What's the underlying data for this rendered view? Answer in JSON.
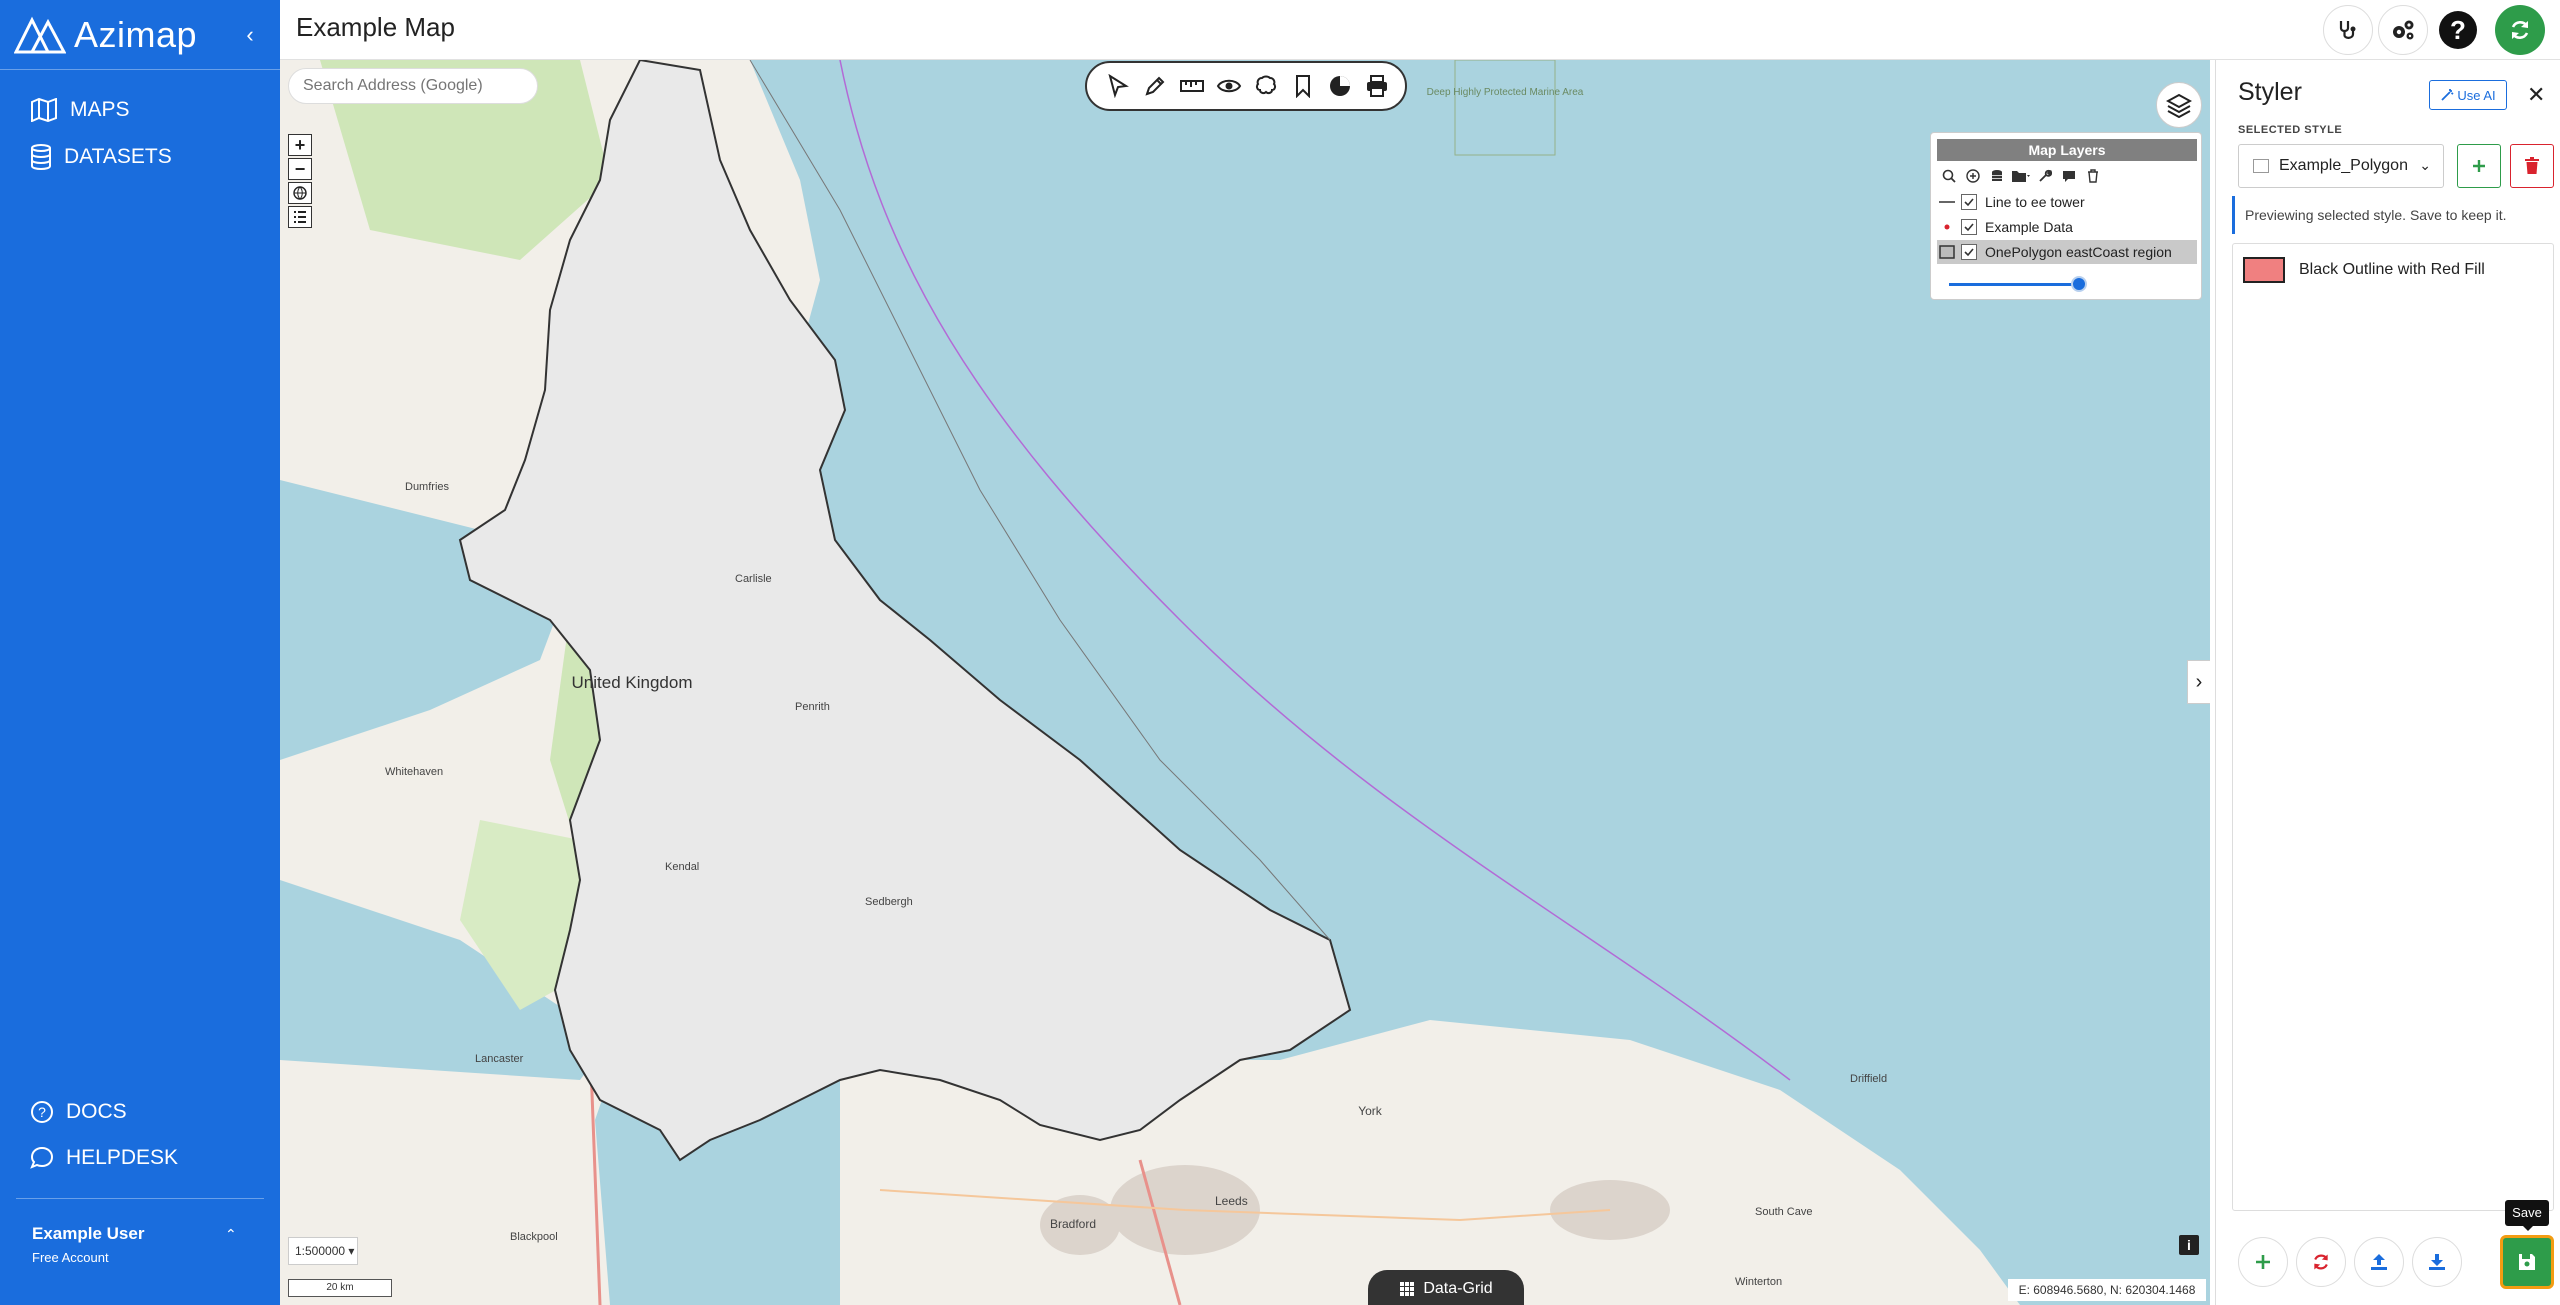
{
  "app": {
    "logo_text": "Azimap",
    "page_title": "Example Map"
  },
  "sidebar": {
    "items": [
      {
        "label": "MAPS",
        "icon": "map-icon"
      },
      {
        "label": "DATASETS",
        "icon": "database-icon"
      }
    ],
    "bottom_items": [
      {
        "label": "DOCS",
        "icon": "question-circle-icon"
      },
      {
        "label": "HELPDESK",
        "icon": "chat-bubble-icon"
      }
    ],
    "user": {
      "name": "Example User",
      "plan": "Free Account"
    }
  },
  "map": {
    "search_placeholder": "Search Address (Google)",
    "scale_value": "1:500000",
    "scale_bar_label": "20 km",
    "coordinates": "E: 608946.5680, N: 620304.1468",
    "data_grid_label": "Data-Grid",
    "place_labels": {
      "uk": "United Kingdom",
      "york": "York",
      "leeds": "Leeds",
      "bradford": "Bradford",
      "lancaster": "Lancaster",
      "kendal": "Kendal",
      "penrith": "Penrith",
      "carlisle": "Carlisle",
      "dumfries": "Dumfries",
      "whitehaven": "Whitehaven",
      "blackpool": "Blackpool",
      "sedbergh": "Sedbergh",
      "south_cave": "South Cave",
      "driffield": "Driffield",
      "winterton": "Winterton",
      "deep_protected": "Deep Highly Protected Marine Area"
    }
  },
  "layers_panel": {
    "title": "Map Layers",
    "layers": [
      {
        "name": "Line to ee tower",
        "checked": true
      },
      {
        "name": "Example Data",
        "checked": true
      },
      {
        "name": "OnePolygon eastCoast region",
        "checked": true,
        "selected": true
      }
    ],
    "opacity": 0.9
  },
  "styler": {
    "title": "Styler",
    "use_ai_label": "Use AI",
    "selected_style_label": "SELECTED STYLE",
    "selected_style": "Example_Polygon",
    "preview_note": "Previewing selected style. Save to keep it.",
    "rules": [
      {
        "name": "Black Outline with Red Fill",
        "fill": "#f08080",
        "outline": "#222222"
      }
    ],
    "save_tooltip": "Save"
  },
  "colors": {
    "brand": "#1a6ddd",
    "success": "#2e9c4a",
    "danger": "#d9232e",
    "highlight": "#f39c12",
    "sea": "#aad3df",
    "land": "#f2efe9",
    "polygon_fill": "#e9e9e9"
  }
}
